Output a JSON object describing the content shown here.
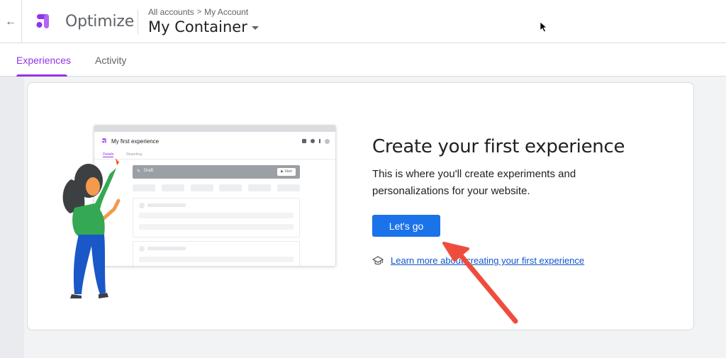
{
  "header": {
    "back_icon": "arrow-back-icon",
    "app_name": "Optimize",
    "breadcrumb": {
      "all_accounts": "All accounts",
      "separator": ">",
      "account": "My Account"
    },
    "container_name": "My Container",
    "brand_color": "#9334e6"
  },
  "tabs": [
    {
      "label": "Experiences",
      "active": true
    },
    {
      "label": "Activity",
      "active": false
    }
  ],
  "empty_state": {
    "headline": "Create your first experience",
    "description": "This is where you'll create experiments and personalizations for your website.",
    "cta_label": "Let's go",
    "cta_color": "#1a73e8",
    "learn_icon": "school-icon",
    "learn_link": "Learn more about creating your first experience"
  },
  "illustration": {
    "mock_title": "My first experience",
    "mock_tabs": [
      "Details",
      "Reporting"
    ],
    "mock_draft": "Draft",
    "mock_start": "Start"
  },
  "annotation": {
    "arrow_color": "#ee4d3d"
  }
}
